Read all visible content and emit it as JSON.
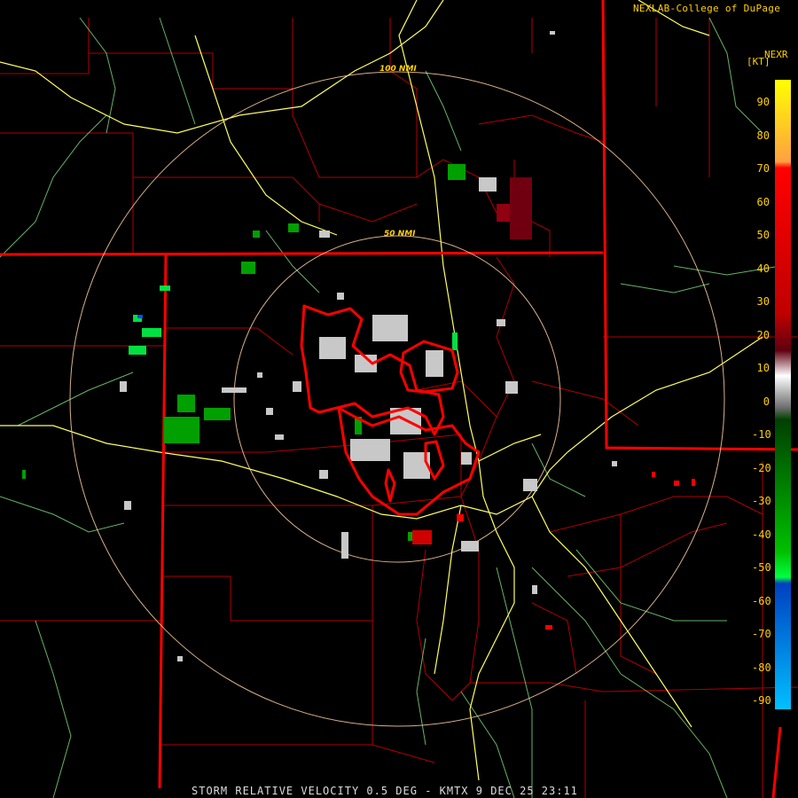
{
  "credit": "NEXLAB-College of DuPage",
  "product": "NEXR",
  "units": "[KT]",
  "footer": "STORM RELATIVE VELOCITY 0.5 DEG - KMTX 9 DEC 25 23:11",
  "ring_labels": [
    "100 NMI",
    "50 NMI"
  ],
  "scale": {
    "ticks": [
      "90",
      "80",
      "70",
      "60",
      "50",
      "40",
      "30",
      "20",
      "10",
      "0",
      "-10",
      "-20",
      "-30",
      "-40",
      "-50",
      "-60",
      "-70",
      "-80",
      "-90"
    ],
    "colors": [
      "#ffff00",
      "#ffa040",
      "#ff0000",
      "#a00000",
      "#600010",
      "#ffffff",
      "#808080",
      "#006000",
      "#00c000",
      "#00ff40",
      "#0040ff",
      "#00c0ff"
    ]
  },
  "colors": {
    "state_border": "#ff0000",
    "county_line": "#b00000",
    "highway": "#ffff60",
    "road": "#80e080",
    "range_ring": "#ffd0a0",
    "warning_polygon": "#ff0000"
  }
}
